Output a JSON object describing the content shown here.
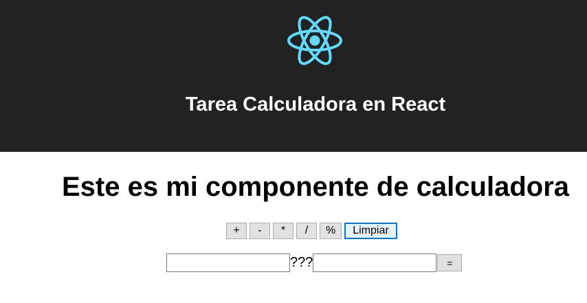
{
  "header": {
    "title": "Tarea Calculadora en React",
    "logo_icon": "react-logo-icon",
    "background": "#222222",
    "logo_color": "#61dafb"
  },
  "main": {
    "heading": "Este es mi componente de calculadora",
    "operations": [
      {
        "label": "+",
        "name": "add-button"
      },
      {
        "label": "-",
        "name": "subtract-button"
      },
      {
        "label": "*",
        "name": "multiply-button"
      },
      {
        "label": "/",
        "name": "divide-button"
      },
      {
        "label": "%",
        "name": "modulo-button"
      },
      {
        "label": "Limpiar",
        "name": "clear-button"
      }
    ],
    "first_number": {
      "value": "",
      "placeholder": ""
    },
    "operator_display": "???",
    "second_number": {
      "value": "",
      "placeholder": ""
    },
    "equals_label": "="
  }
}
